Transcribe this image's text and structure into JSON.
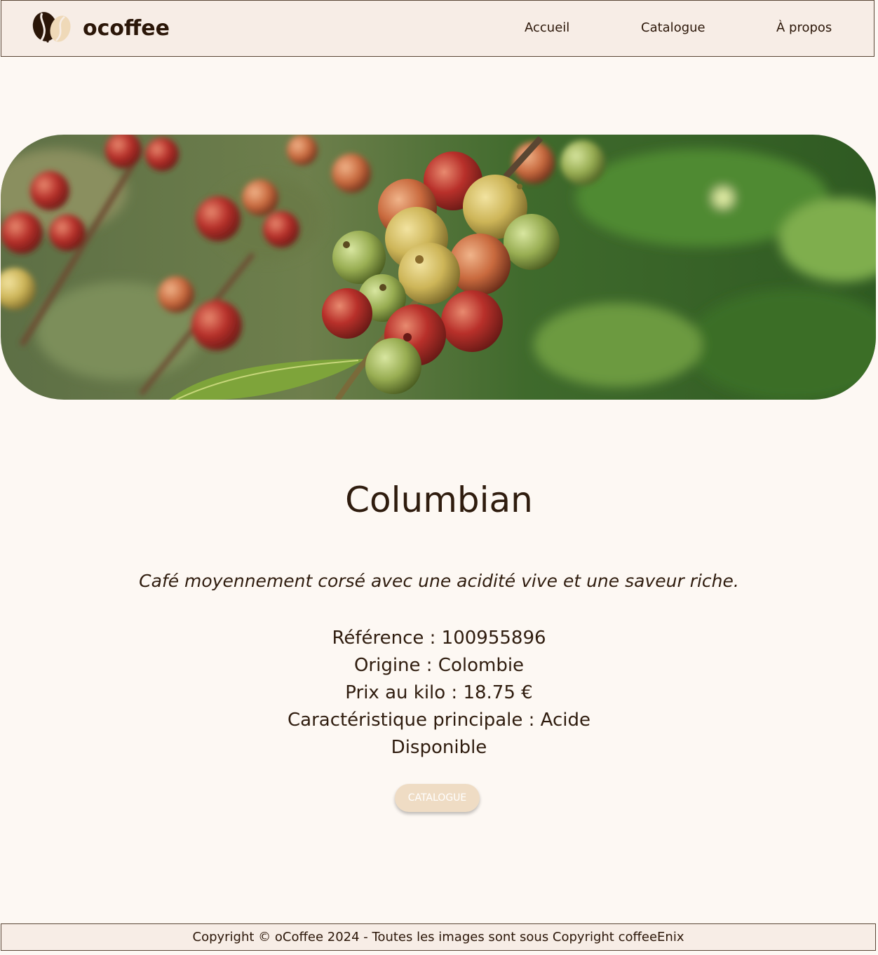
{
  "header": {
    "brand": "ocoffee",
    "nav": [
      {
        "label": "Accueil"
      },
      {
        "label": "Catalogue"
      },
      {
        "label": "À propos"
      }
    ]
  },
  "product": {
    "name": "Columbian",
    "description": "Café moyennement corsé avec une acidité vive et une saveur riche.",
    "reference": "Référence : 100955896",
    "origin": "Origine : Colombie",
    "price": "Prix au kilo : 18.75 €",
    "characteristic": "Caractéristique principale : Acide",
    "availability": "Disponible"
  },
  "cta": {
    "label": "CATALOGUE"
  },
  "footer": {
    "text": "Copyright © oCoffee 2024 - Toutes les images sont sous Copyright coffeeEnix"
  },
  "colors": {
    "background": "#fdf8f3",
    "header_bg": "#f7ede6",
    "text": "#2f1c0e",
    "button_bg": "#efdcc4"
  }
}
